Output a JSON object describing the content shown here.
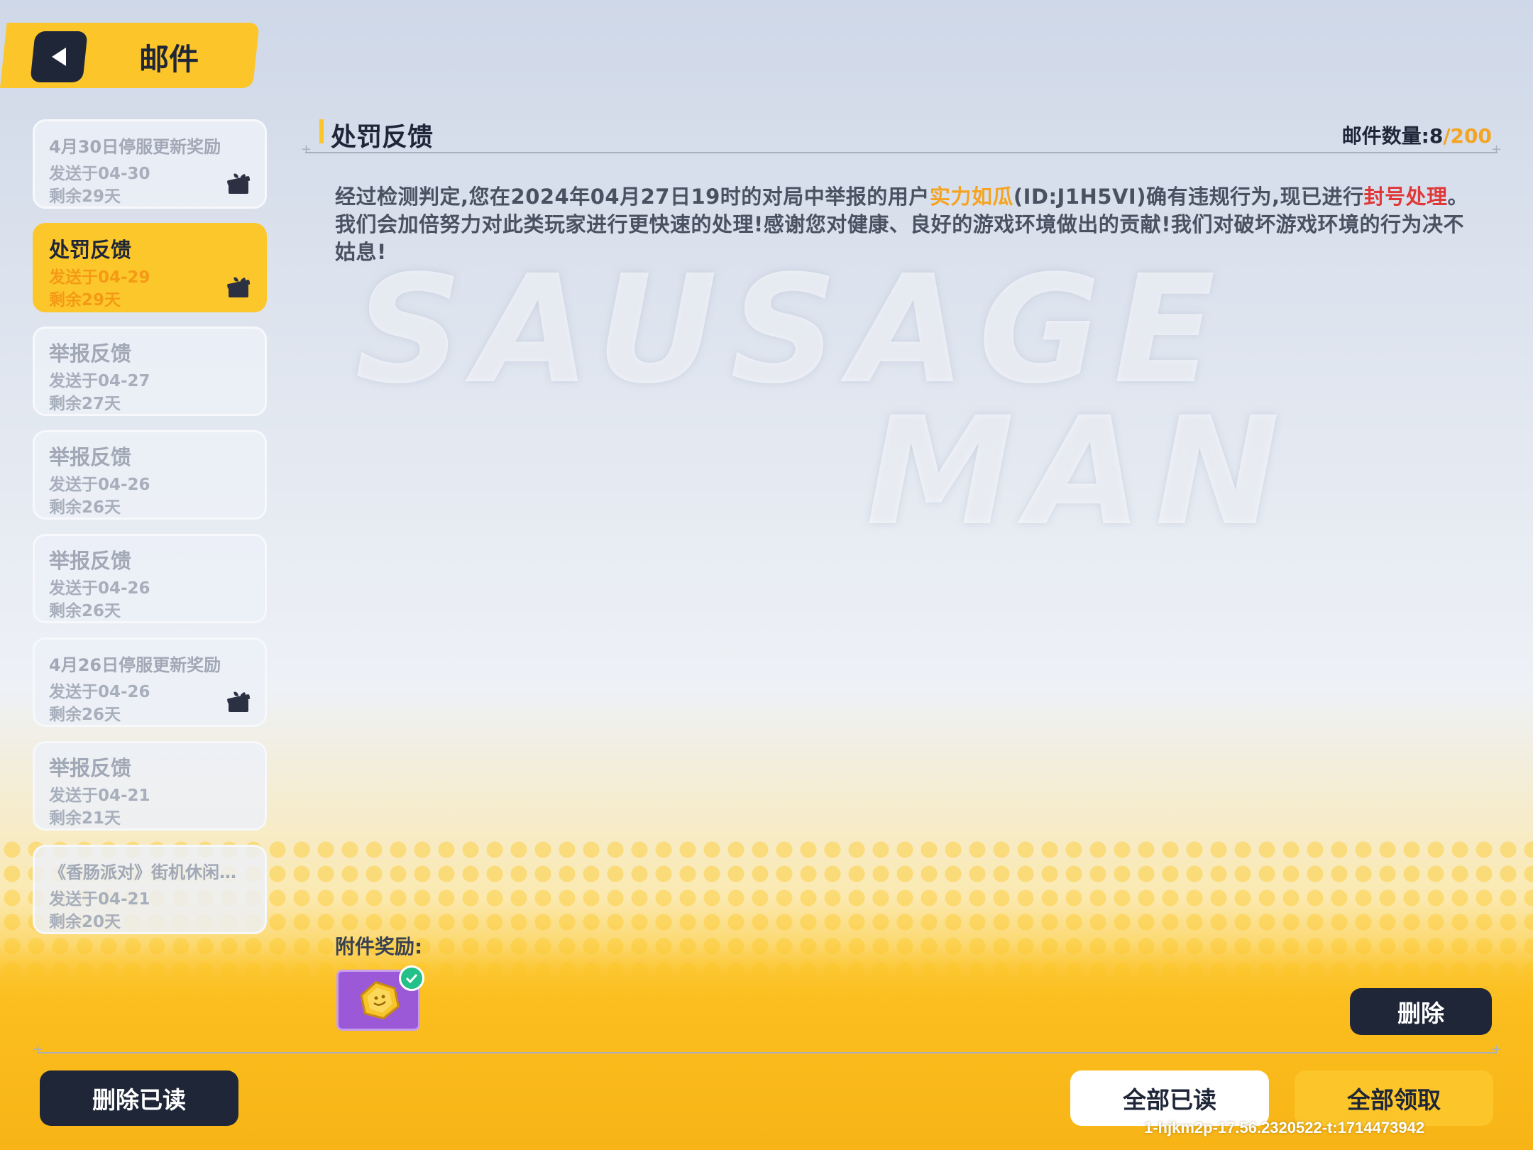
{
  "header": {
    "title": "邮件"
  },
  "mail_list": [
    {
      "title": "4月30日停服更新奖励",
      "date": "发送于04-30",
      "remain": "剩余29天",
      "has_gift": true,
      "active": false
    },
    {
      "title": "处罚反馈",
      "date": "发送于04-29",
      "remain": "剩余29天",
      "has_gift": true,
      "active": true
    },
    {
      "title": "举报反馈",
      "date": "发送于04-27",
      "remain": "剩余27天",
      "has_gift": false,
      "active": false
    },
    {
      "title": "举报反馈",
      "date": "发送于04-26",
      "remain": "剩余26天",
      "has_gift": false,
      "active": false
    },
    {
      "title": "举报反馈",
      "date": "发送于04-26",
      "remain": "剩余26天",
      "has_gift": false,
      "active": false
    },
    {
      "title": "4月26日停服更新奖励",
      "date": "发送于04-26",
      "remain": "剩余26天",
      "has_gift": true,
      "active": false
    },
    {
      "title": "举报反馈",
      "date": "发送于04-21",
      "remain": "剩余21天",
      "has_gift": false,
      "active": false
    },
    {
      "title": "《香肠派对》街机休闲…",
      "date": "发送于04-21",
      "remain": "剩余20天",
      "has_gift": false,
      "active": false
    }
  ],
  "content": {
    "title": "处罚反馈",
    "count_label": "邮件数量:",
    "count_current": "8",
    "count_sep": "/",
    "count_max": "200",
    "body_part1": "经过检测判定,您在2024年04月27日19时的对局中举报的用户",
    "body_user": "实力如瓜",
    "body_part2": "(ID:J1H5VI)确有违规行为,现已进行",
    "body_action": "封号处理",
    "body_part3": "。我们会加倍努力对此类玩家进行更快速的处理!感谢您对健康、良好的游戏环境做出的贡献!我们对破坏游戏环境的行为决不姑息!",
    "attachment_label": "附件奖励:",
    "attachment_claimed": true
  },
  "watermark": {
    "line1": "SAUSAGE",
    "line2": "MAN"
  },
  "buttons": {
    "delete": "删除",
    "delete_read": "删除已读",
    "read_all": "全部已读",
    "claim_all": "全部领取"
  },
  "build_info": "1-hjkm2p-17.56.2320522-t:1714473942",
  "colors": {
    "accent": "#fcc52a",
    "dark": "#1e2638",
    "highlight_orange": "#f4a421",
    "highlight_red": "#e03838",
    "attachment_purple": "#9b59d8"
  }
}
